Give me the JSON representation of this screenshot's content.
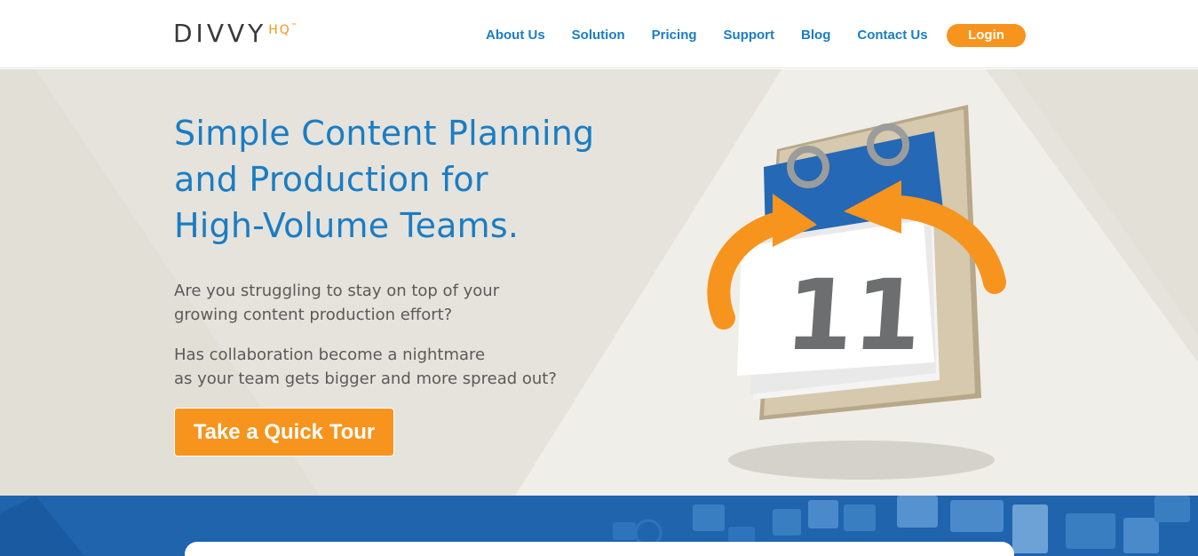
{
  "header": {
    "logo_main": "DIVVY",
    "logo_hq": "HQ",
    "logo_tm": "™",
    "nav": [
      "About Us",
      "Solution",
      "Pricing",
      "Support",
      "Blog",
      "Contact Us"
    ],
    "login_label": "Login"
  },
  "hero": {
    "headline_line1": "Simple Content Planning",
    "headline_line2": "and Production for",
    "headline_line3": "High-Volume Teams.",
    "para1_line1": "Are you struggling to stay on top of your",
    "para1_line2": "growing content production effort?",
    "para2_line1": "Has collaboration become a nightmare",
    "para2_line2": "as your team gets bigger and more spread out?",
    "cta_label": "Take a Quick Tour",
    "calendar_number": "11"
  },
  "colors": {
    "brand_blue": "#1a7dc4",
    "brand_orange": "#f7941d",
    "hero_bg": "#e6e3dc",
    "band_blue": "#1f64ad"
  }
}
